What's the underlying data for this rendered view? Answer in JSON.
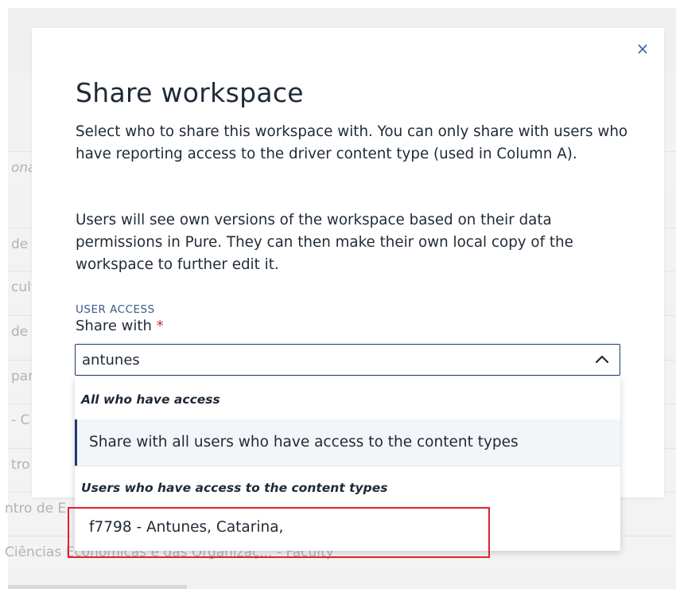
{
  "background": {
    "rows": [
      {
        "text": "ona",
        "italic": true
      },
      {
        "text": "de",
        "italic": false
      },
      {
        "text": "cult",
        "italic": false
      },
      {
        "text": "de",
        "italic": false
      },
      {
        "text": "par",
        "italic": false
      },
      {
        "text": "- C",
        "italic": false
      },
      {
        "text": "tro",
        "italic": false
      },
      {
        "text": "ntro de E",
        "italic": false
      },
      {
        "text": "Ciências Económicas e das Organizaç... - Faculty",
        "italic": false
      }
    ]
  },
  "modal": {
    "close_icon": "×",
    "title": "Share workspace",
    "paragraph1": "Select who to share this workspace with. You can only share with users who have reporting access to the driver content type (used in Column A).",
    "paragraph2": "Users will see own versions of the workspace based on their data permissions in Pure. They can then make their own local copy of the workspace to further edit it.",
    "section_label": "USER ACCESS",
    "field_label": "Share with",
    "required_marker": "*",
    "input_value": "antunes",
    "chevron_icon": "chevron-up-icon"
  },
  "dropdown": {
    "group1_header": "All who have access",
    "option_all": "Share with all users who have access to the content types",
    "group2_header": "Users who have access to the content types",
    "option_user": "f7798 - Antunes, Catarina,"
  },
  "colors": {
    "accent": "#1d3a6e",
    "close": "#3a62a8",
    "required": "#cc2a2a",
    "highlight": "#e0232b"
  }
}
